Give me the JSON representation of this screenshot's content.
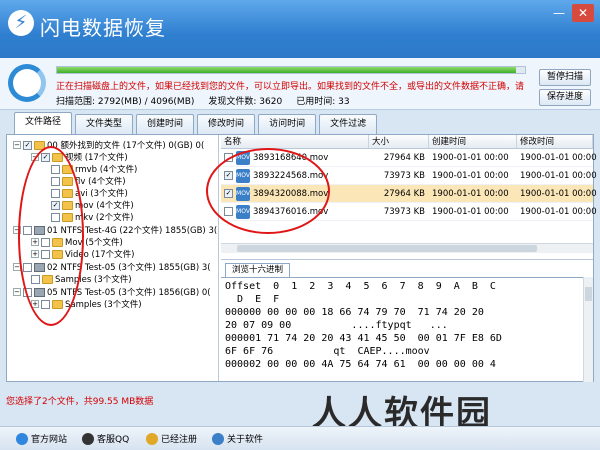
{
  "app": {
    "title": "闪电数据恢复"
  },
  "scan": {
    "progress": 0.98,
    "message": "正在扫描磁盘上的文件，如果已经找到您的文件，可以立即导出。如果找到的文件不全，或导出的文件数据不正确，请",
    "range": "扫描范围: 2792(MB) / 4096(MB)",
    "found": "发现文件数:  3620",
    "elapsed": "已用时间:  33",
    "pause_label": "暂停扫描",
    "save_label": "保存进度"
  },
  "tabs": [
    "文件路径",
    "文件类型",
    "创建时间",
    "修改时间",
    "访问时间",
    "文件过滤"
  ],
  "tree": [
    {
      "label": "00  额外找到的文件    (17个文件)  0(GB)  0("
    },
    {
      "label": "视频      (17个文件)"
    },
    {
      "label": "rmvb     (4个文件)"
    },
    {
      "label": "flv      (4个文件)"
    },
    {
      "label": "avi      (3个文件)"
    },
    {
      "label": "mov      (4个文件)"
    },
    {
      "label": "mkv      (2个文件)"
    },
    {
      "label": "01  NTFS Test-4G   (22个文件)  1855(GB)  3("
    },
    {
      "label": "Mov     (5个文件)"
    },
    {
      "label": "Video    (17个文件)"
    },
    {
      "label": "02  NTFS Test-05   (3个文件)  1855(GB)  3("
    },
    {
      "label": "Samples    (3个文件)"
    },
    {
      "label": "05  NTFS Test-05   (3个文件)  1856(GB)  0("
    },
    {
      "label": "Samples    (3个文件)"
    }
  ],
  "filelist": {
    "headers": [
      "名称",
      "大小",
      "创建时间",
      "修改时间"
    ],
    "rows": [
      {
        "name": "3893168640.mov",
        "size": "27964 KB",
        "created": "1900-01-01 00:00",
        "modified": "1900-01-01 00:00"
      },
      {
        "name": "3893224568.mov",
        "size": "73973 KB",
        "created": "1900-01-01 00:00",
        "modified": "1900-01-01 00:00"
      },
      {
        "name": "3894320088.mov",
        "size": "27964 KB",
        "created": "1900-01-01 00:00",
        "modified": "1900-01-01 00:00"
      },
      {
        "name": "3894376016.mov",
        "size": "73973 KB",
        "created": "1900-01-01 00:00",
        "modified": "1900-01-01 00:00"
      }
    ]
  },
  "hex": {
    "tab_label": "浏览十六进制",
    "lines": [
      "Offset  0  1  2  3  4  5  6  7  8  9  A  B  C",
      "  D  E  F",
      "000000 00 00 00 18 66 74 79 70  71 74 20 20",
      "20 07 09 00          ....ftypqt   ...",
      "000001 71 74 20 20 43 41 45 50  00 01 7F E8 6D",
      "6F 6F 76          qt  CAEP....moov",
      "000002 00 00 00 4A 75 64 74 61  00 00 00 00 4"
    ]
  },
  "status": {
    "selection": "您选择了2个文件，共99.55 MB数据"
  },
  "bottom": {
    "website": "官方网站",
    "qq": "客服QQ",
    "registered": "已经注册",
    "about": "关于软件"
  },
  "watermark": "人人软件园"
}
